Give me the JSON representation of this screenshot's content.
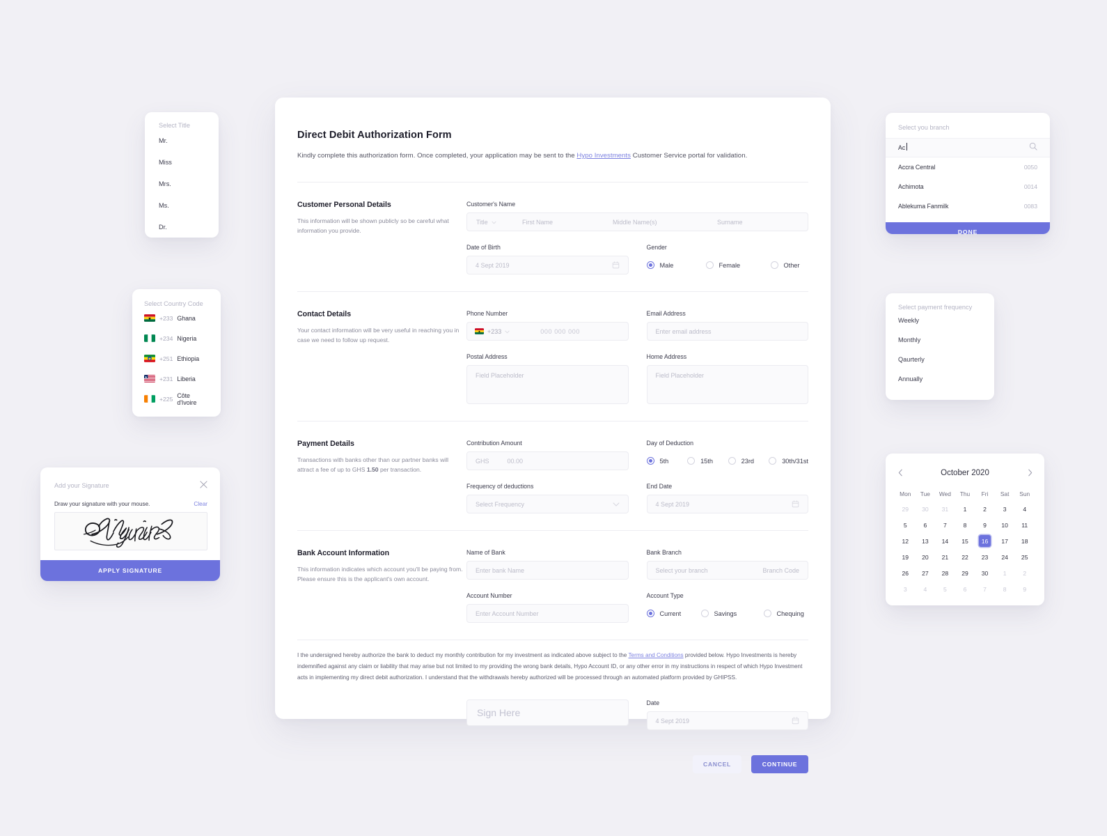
{
  "form": {
    "title": "Direct Debit Authorization Form",
    "subtitle_pre": "Kindly complete this authorization form. Once completed, your application may be sent to the ",
    "subtitle_link": "Hypo Investments",
    "subtitle_post": " Customer Service portal for validation.",
    "sections": {
      "personal": {
        "title": "Customer Personal Details",
        "desc": "This information will be shown publicly so be careful what information you provide.",
        "name_label": "Customer's Name",
        "name_title_ph": "Title",
        "name_first_ph": "First Name",
        "name_middle_ph": "Middle Name(s)",
        "name_last_ph": "Surname",
        "dob_label": "Date of Birth",
        "dob_ph": "4 Sept 2019",
        "gender_label": "Gender",
        "gender_options": [
          "Male",
          "Female",
          "Other"
        ],
        "gender_selected": "Male"
      },
      "contact": {
        "title": "Contact Details",
        "desc": "Your contact information will be very useful in reaching you in case we need to follow up request.",
        "phone_label": "Phone Number",
        "phone_code": "+233",
        "phone_ph": "000 000 000",
        "email_label": "Email Address",
        "email_ph": "Enter email address",
        "postal_label": "Postal Address",
        "postal_ph": "Field Placeholder",
        "home_label": "Home Address",
        "home_ph": "Field Placeholder"
      },
      "payment": {
        "title": "Payment Details",
        "desc_pre": "Transactions with banks other than our partner banks will attract a fee of up to GHS ",
        "desc_bold": "1.50",
        "desc_post": " per transaction.",
        "amount_label": "Contribution Amount",
        "amount_currency": "GHS",
        "amount_ph": "00.00",
        "day_label": "Day of Deduction",
        "day_options": [
          "5th",
          "15th",
          "23rd",
          "30th/31st"
        ],
        "day_selected": "5th",
        "freq_label": "Frequency of deductions",
        "freq_ph": "Select Frequency",
        "enddate_label": "End Date",
        "enddate_ph": "4 Sept 2019"
      },
      "bank": {
        "title": "Bank Account Information",
        "desc": "This information indicates which account you'll be paying from. Please ensure this is the applicant's own account.",
        "bankname_label": "Name of Bank",
        "bankname_ph": "Enter bank Name",
        "branch_label": "Bank Branch",
        "branch_ph": "Select your branch",
        "branchcode_ph": "Branch Code",
        "acctnum_label": "Account Number",
        "acctnum_ph": "Enter Account Number",
        "accttype_label": "Account Type",
        "accttype_options": [
          "Current",
          "Savings",
          "Chequing"
        ],
        "accttype_selected": "Current"
      }
    },
    "legal_pre": "I the undersigned hereby authorize the bank to deduct my monthly contribution for my investment as indicated above subject to the ",
    "legal_link": "Terms and Conditions",
    "legal_post": " provided below. Hypo Investments is hereby indemnified against any claim or liability that may arise but not limited to my providing the wrong bank details, Hypo Account ID, or any other error in my instructions in respect of which Hypo Investment acts in implementing my direct debit authorization. I understand that the withdrawals hereby authorized will be processed through an automated platform provided by GHIPSS.",
    "sign_ph": "Sign Here",
    "sign_date_label": "Date",
    "sign_date_ph": "4 Sept 2019",
    "cancel_label": "CANCEL",
    "continue_label": "CONTINUE"
  },
  "title_panel": {
    "header": "Select Title",
    "items": [
      "Mr.",
      "Miss",
      "Mrs.",
      "Ms.",
      "Dr."
    ]
  },
  "country_panel": {
    "header": "Select Country Code",
    "items": [
      {
        "flag": "ghana-flag-icon",
        "code": "+233",
        "name": "Ghana"
      },
      {
        "flag": "nigeria-flag-icon",
        "code": "+234",
        "name": "Nigeria"
      },
      {
        "flag": "ethiopia-flag-icon",
        "code": "+251",
        "name": "Ethiopia"
      },
      {
        "flag": "liberia-flag-icon",
        "code": "+231",
        "name": "Liberia"
      },
      {
        "flag": "ivorycoast-flag-icon",
        "code": "+225",
        "name": "Côte d'Ivoire"
      }
    ]
  },
  "signature_panel": {
    "header": "Add your Signature",
    "instruction": "Draw your signature with your mouse.",
    "clear_label": "Clear",
    "apply_label": "APPLY SIGNATURE",
    "close_icon": "close-icon"
  },
  "branch_panel": {
    "header": "Select you branch",
    "search_value": "Ac",
    "search_icon": "search-icon",
    "items": [
      {
        "name": "Accra Central",
        "code": "0050"
      },
      {
        "name": "Achimota",
        "code": "0014"
      },
      {
        "name": "Ablekuma Fanmilk",
        "code": "0083"
      }
    ],
    "done_label": "DONE"
  },
  "frequency_panel": {
    "header": "Select payment frequency",
    "items": [
      "Weekly",
      "Monthly",
      "Qaurterly",
      "Annually"
    ]
  },
  "calendar_panel": {
    "title": "October 2020",
    "prev_icon": "chevron-left-icon",
    "next_icon": "chevron-right-icon",
    "dow": [
      "Mon",
      "Tue",
      "Wed",
      "Thu",
      "Fri",
      "Sat",
      "Sun"
    ],
    "selected_day": 16,
    "weeks": [
      [
        {
          "d": 29,
          "m": true
        },
        {
          "d": 30,
          "m": true
        },
        {
          "d": 31,
          "m": true
        },
        {
          "d": 1,
          "m": false
        },
        {
          "d": 2,
          "m": false
        },
        {
          "d": 3,
          "m": false
        },
        {
          "d": 4,
          "m": false
        }
      ],
      [
        {
          "d": 5,
          "m": false
        },
        {
          "d": 6,
          "m": false
        },
        {
          "d": 7,
          "m": false
        },
        {
          "d": 8,
          "m": false
        },
        {
          "d": 9,
          "m": false
        },
        {
          "d": 10,
          "m": false
        },
        {
          "d": 11,
          "m": false
        }
      ],
      [
        {
          "d": 12,
          "m": false
        },
        {
          "d": 13,
          "m": false
        },
        {
          "d": 14,
          "m": false
        },
        {
          "d": 15,
          "m": false
        },
        {
          "d": 16,
          "m": false,
          "sel": true
        },
        {
          "d": 17,
          "m": false
        },
        {
          "d": 18,
          "m": false
        }
      ],
      [
        {
          "d": 19,
          "m": false
        },
        {
          "d": 20,
          "m": false
        },
        {
          "d": 21,
          "m": false
        },
        {
          "d": 22,
          "m": false
        },
        {
          "d": 23,
          "m": false
        },
        {
          "d": 24,
          "m": false
        },
        {
          "d": 25,
          "m": false
        }
      ],
      [
        {
          "d": 26,
          "m": false
        },
        {
          "d": 27,
          "m": false
        },
        {
          "d": 28,
          "m": false
        },
        {
          "d": 29,
          "m": false
        },
        {
          "d": 30,
          "m": false
        },
        {
          "d": 1,
          "m": true
        },
        {
          "d": 2,
          "m": true
        }
      ],
      [
        {
          "d": 3,
          "m": true
        },
        {
          "d": 4,
          "m": true
        },
        {
          "d": 5,
          "m": true
        },
        {
          "d": 6,
          "m": true
        },
        {
          "d": 7,
          "m": true
        },
        {
          "d": 8,
          "m": true
        },
        {
          "d": 9,
          "m": true
        }
      ]
    ]
  },
  "colors": {
    "accent": "#6c72dd",
    "background": "#f1f0f5",
    "card": "#ffffff",
    "field_bg": "#fafafc",
    "placeholder": "#bcbcc9",
    "link": "#7b80e0"
  }
}
